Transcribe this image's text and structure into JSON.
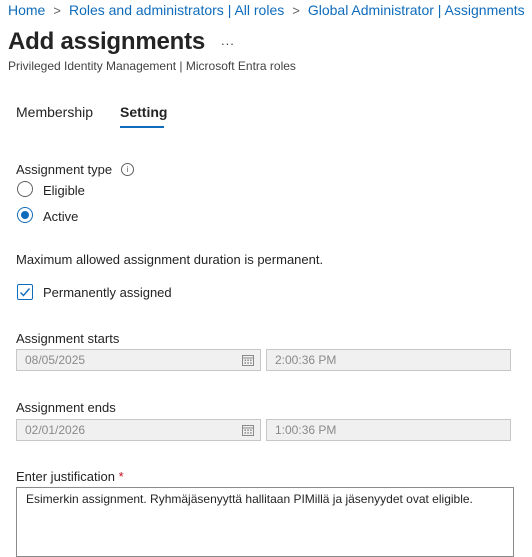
{
  "breadcrumb": {
    "items": [
      "Home",
      "Roles and administrators | All roles",
      "Global Administrator | Assignments"
    ],
    "separator": ">"
  },
  "page": {
    "title": "Add assignments",
    "more_label": "...",
    "subtitle": "Privileged Identity Management | Microsoft Entra roles"
  },
  "tabs": [
    {
      "label": "Membership",
      "active": false
    },
    {
      "label": "Setting",
      "active": true
    }
  ],
  "assignment_type": {
    "label": "Assignment type",
    "info_icon": "info-icon",
    "options": [
      {
        "label": "Eligible",
        "checked": false
      },
      {
        "label": "Active",
        "checked": true
      }
    ]
  },
  "duration_note": "Maximum allowed assignment duration is permanent.",
  "permanent": {
    "label": "Permanently assigned",
    "checked": true
  },
  "starts": {
    "label": "Assignment starts",
    "date": "08/05/2025",
    "time": "2:00:36 PM"
  },
  "ends": {
    "label": "Assignment ends",
    "date": "02/01/2026",
    "time": "1:00:36 PM"
  },
  "justification": {
    "label": "Enter justification",
    "required_mark": "*",
    "value": "Esimerkin assignment. Ryhmäjäsenyyttä hallitaan PIMillä ja jäsenyydet ovat eligible."
  },
  "colors": {
    "accent": "#0f6cbd",
    "required": "#c50f1f",
    "disabled_bg": "#f0f0f0"
  }
}
